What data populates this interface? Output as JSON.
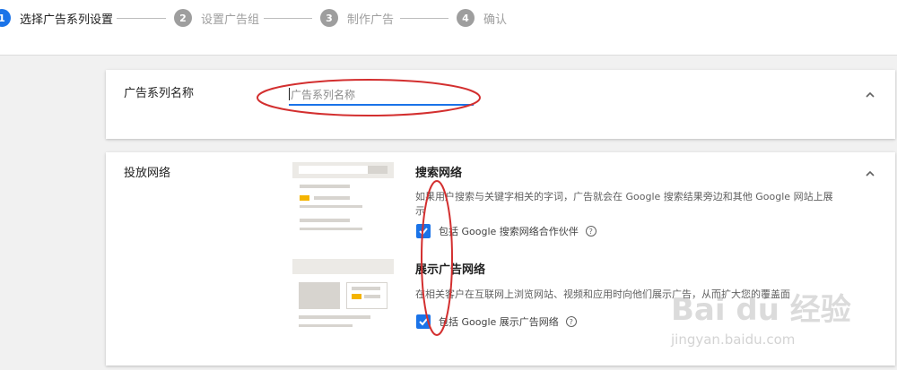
{
  "stepper": {
    "steps": [
      {
        "num": "1",
        "label": "选择广告系列设置"
      },
      {
        "num": "2",
        "label": "设置广告组"
      },
      {
        "num": "3",
        "label": "制作广告"
      },
      {
        "num": "4",
        "label": "确认"
      }
    ]
  },
  "campaign_name": {
    "title": "广告系列名称",
    "placeholder": "广告系列名称",
    "value": ""
  },
  "networks": {
    "title": "投放网络",
    "search": {
      "title": "搜索网络",
      "desc": "如果用户搜索与关键字相关的字词，广告就会在 Google 搜索结果旁边和其他 Google 网站上展示",
      "checkbox_label": "包括 Google 搜索网络合作伙伴",
      "checked": true,
      "help": "?"
    },
    "display": {
      "title": "展示广告网络",
      "desc": "在相关客户在互联网上浏览网站、视频和应用时向他们展示广告，从而扩大您的覆盖面",
      "checkbox_label": "包括 Google 展示广告网络",
      "checked": true,
      "help": "?"
    }
  },
  "watermark": {
    "logo": "Bai du 经验",
    "url": "jingyan.baidu.com"
  },
  "colors": {
    "accent": "#1a73e8",
    "annotation": "#d32f2f",
    "thumb_highlight": "#f4b400"
  }
}
